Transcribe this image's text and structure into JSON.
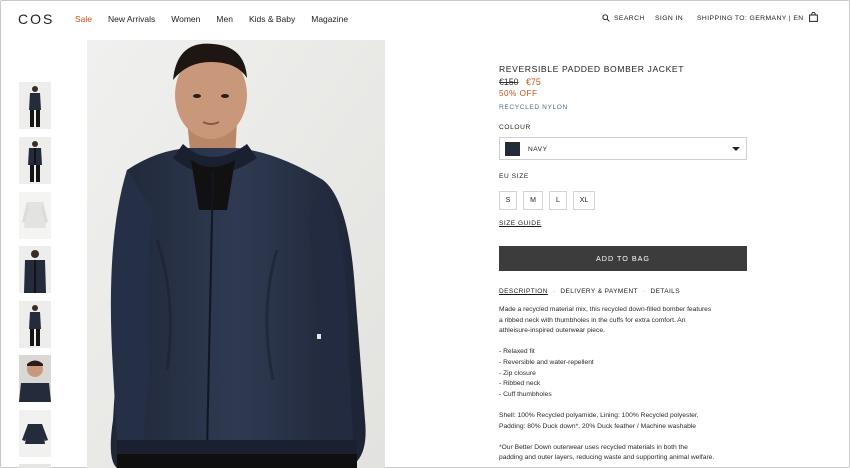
{
  "header": {
    "logo": "COS",
    "nav": [
      "Sale",
      "New Arrivals",
      "Women",
      "Men",
      "Kids & Baby",
      "Magazine"
    ],
    "search_label": "SEARCH",
    "signin_label": "SIGN IN",
    "shipping_label": "SHIPPING TO: GERMANY | EN",
    "bag_icon": "shopping-bag-icon",
    "search_icon": "search-icon"
  },
  "gallery": {
    "thumbnails": [
      "front-full",
      "front-full-open",
      "knit-flat",
      "front-crop",
      "front-full-alt",
      "close-up",
      "flat-lay"
    ],
    "main_image": "model-wearing-jacket"
  },
  "product": {
    "title": "REVERSIBLE PADDED BOMBER JACKET",
    "old_price": "€150",
    "new_price": "€75",
    "discount": "50% OFF",
    "material": "RECYCLED NYLON",
    "colour_label": "COLOUR",
    "colour_value": "NAVY",
    "size_label": "EU SIZE",
    "sizes": [
      "S",
      "M",
      "L",
      "XL"
    ],
    "size_guide": "SIZE GUIDE",
    "add_to_bag": "ADD TO BAG",
    "tabs": [
      "DESCRIPTION",
      "DELIVERY & PAYMENT",
      "DETAILS"
    ],
    "tab_separator": "·",
    "description": [
      "Made a recycled material mix, this recycled down-filled bomber features",
      "a ribbed neck with thumbholes in the cuffs for extra comfort. An",
      "athleisure-inspired outerwear piece.",
      "",
      "- Relaxed fit",
      "- Reversible and water-repellent",
      "- Zip closure",
      "- Ribbed neck",
      "- Cuff thumbholes",
      "",
      "Shell: 100% Recycled polyamide, Lining: 100% Recycled polyester,",
      "Padding: 80% Duck down*, 20% Duck feather / Machine washable",
      "",
      "*Our Better Down outerwear uses recycled materials in both the",
      "padding and outer layers, reducing waste and supporting animal welfare."
    ]
  },
  "colors": {
    "sale": "#c5521c",
    "accent_link": "#4b6f8f",
    "button": "#3c3c3c",
    "navy": "#232a38"
  }
}
